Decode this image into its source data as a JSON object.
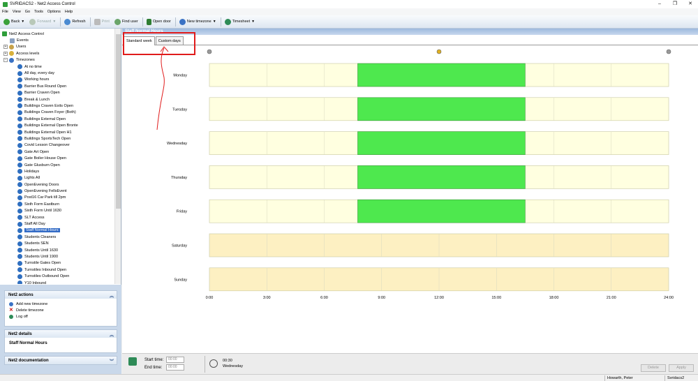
{
  "window": {
    "title": "SVRIDACS2 - Net2 Access Control",
    "controls": [
      "–",
      "❐",
      "✕"
    ]
  },
  "menu": [
    "File",
    "View",
    "Go",
    "Tools",
    "Options",
    "Help"
  ],
  "toolbar": {
    "back": "Back",
    "forward": "Forward",
    "refresh": "Refresh",
    "print": "Print",
    "find_user": "Find user",
    "open_door": "Open door",
    "new_timezone": "New timezone",
    "timesheet": "Timesheet"
  },
  "tree": {
    "root": "Net2 Access Control",
    "events": "Events",
    "users": "Users",
    "access_levels": "Access levels",
    "timezones": "Timezones",
    "items": [
      "At no time",
      "All day, every day",
      "Working hours",
      "Barrier Bus Round Open",
      "Barrier Craven Open",
      "Break & Lunch",
      "Buildings Craven Exits Open",
      "Buildings Craven Foyer (Both)",
      "Buildings External Open",
      "Buildings External Open Bronte",
      "Buildings External Open H1",
      "Buildings SportsTech Open",
      "Covid Lesson Changeover",
      "Gate Art Open",
      "Gate Boiler House Open",
      "Gate Glusburn Open",
      "Holidays",
      "Lights All",
      "OpenEvening Doors",
      "OpenEvening FellsEvent",
      "Post16 Car Park till 2pm",
      "Sixth Form Eastburn",
      "Sixth Form Until 1630",
      "SLT Access",
      "Staff All Day",
      "Staff Normal Hours",
      "Students Cleaners",
      "Students SEN",
      "Students Until 1630",
      "Students Until 1900",
      "Turnstile Gates Open",
      "Turnstiles Inbound Open",
      "Turnstiles Outbound Open",
      "Y10 Inbound"
    ],
    "selected": "Staff Normal Hours"
  },
  "panels": {
    "actions": {
      "title": "Net2 actions",
      "items": [
        "Add new timezone",
        "Delete timezone",
        "Log off"
      ]
    },
    "details": {
      "title": "Net2 details",
      "value": "Staff Normal Hours"
    },
    "documentation": {
      "title": "Net2 documentation"
    }
  },
  "main": {
    "header": "Staff Normal Hours",
    "tabs": [
      "Standard week",
      "Custom days"
    ]
  },
  "chart_data": {
    "type": "bar",
    "orientation": "horizontal-timeline",
    "categories": [
      "Monday",
      "Tuesday",
      "Wednesday",
      "Thursday",
      "Friday",
      "Saturday",
      "Sunday"
    ],
    "x_ticks": [
      "0:00",
      "3:00",
      "6:00",
      "9:00",
      "12:00",
      "15:00",
      "18:00",
      "21:00",
      "24:00"
    ],
    "xlim": [
      0,
      24
    ],
    "intervals": [
      {
        "day": "Monday",
        "start": 7.75,
        "end": 16.5
      },
      {
        "day": "Tuesday",
        "start": 7.75,
        "end": 16.5
      },
      {
        "day": "Wednesday",
        "start": 7.75,
        "end": 16.5
      },
      {
        "day": "Thursday",
        "start": 7.75,
        "end": 16.5
      },
      {
        "day": "Friday",
        "start": 7.75,
        "end": 16.5
      }
    ],
    "colors": {
      "active": "#4ee84e",
      "weekday_bg": "#ffffe0",
      "weekend_bg": "#fdf0c2"
    }
  },
  "bottom": {
    "start_label": "Start time:",
    "end_label": "End time:",
    "start_value": "00:00",
    "end_value": "00:00",
    "cursor_time": "00:30",
    "cursor_day": "Wednesday",
    "delete": "Delete",
    "apply": "Apply"
  },
  "status": {
    "user": "Howarth, Peter",
    "server": "Svridacs2"
  }
}
